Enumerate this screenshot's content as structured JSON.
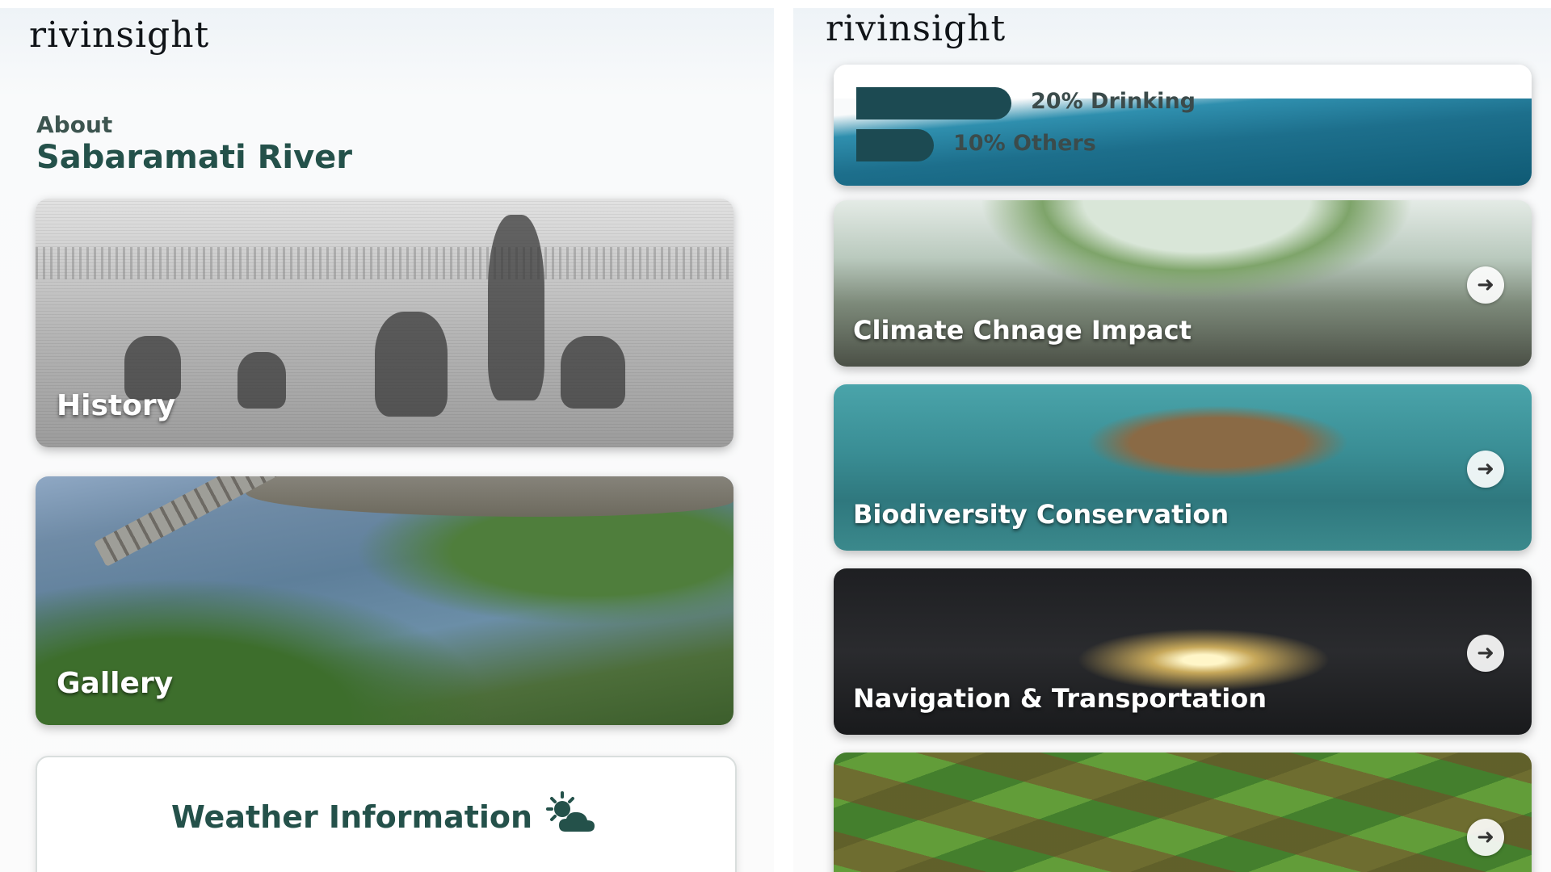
{
  "left_screen": {
    "logo": "rivinsight",
    "about_label": "About",
    "river_title": "Sabaramati River",
    "cards": {
      "history": "History",
      "gallery": "Gallery",
      "weather": "Weather Information"
    },
    "icons": {
      "weather": "partly-cloudy-icon"
    }
  },
  "right_screen": {
    "logo": "rivinsight",
    "usage": [
      {
        "label": "20% Drinking",
        "percent": 20
      },
      {
        "label": "10% Others",
        "percent": 10
      }
    ],
    "cards": {
      "climate": "Climate Chnage Impact",
      "biodiversity": "Biodiversity Conservation",
      "navigation": "Navigation & Transportation"
    },
    "icons": {
      "arrow": "arrow-right-icon"
    }
  },
  "colors": {
    "primary_green": "#24514a",
    "usage_bar": "#1c4a52"
  }
}
